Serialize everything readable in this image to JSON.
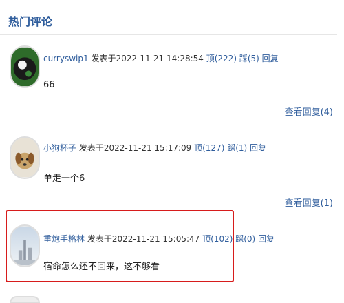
{
  "header": {
    "title": "热门评论"
  },
  "comments": [
    {
      "user": "curryswip1",
      "posted": "发表于2022-11-21 14:28:54",
      "up": "顶(222)",
      "down": "踩(5)",
      "reply": "回复",
      "text": "66",
      "view_replies": "查看回复(4)",
      "avatar": "billiard-ball-avatar"
    },
    {
      "user": "小狗杯子",
      "posted": "发表于2022-11-21 15:17:09",
      "up": "顶(127)",
      "down": "踩(1)",
      "reply": "回复",
      "text": "单走一个6",
      "view_replies": "查看回复(1)",
      "avatar": "puppy-avatar"
    },
    {
      "user": "重炮手格林",
      "posted": "发表于2022-11-21 15:05:47",
      "up": "顶(102)",
      "down": "踩(0)",
      "reply": "回复",
      "text": "宿命怎么还不回来，这不够看",
      "avatar": "city-skyline-avatar"
    },
    {
      "user": "",
      "posted": "",
      "partial": true
    }
  ],
  "colors": {
    "link": "#2f5d9c",
    "highlight_border": "#d71c1c"
  }
}
